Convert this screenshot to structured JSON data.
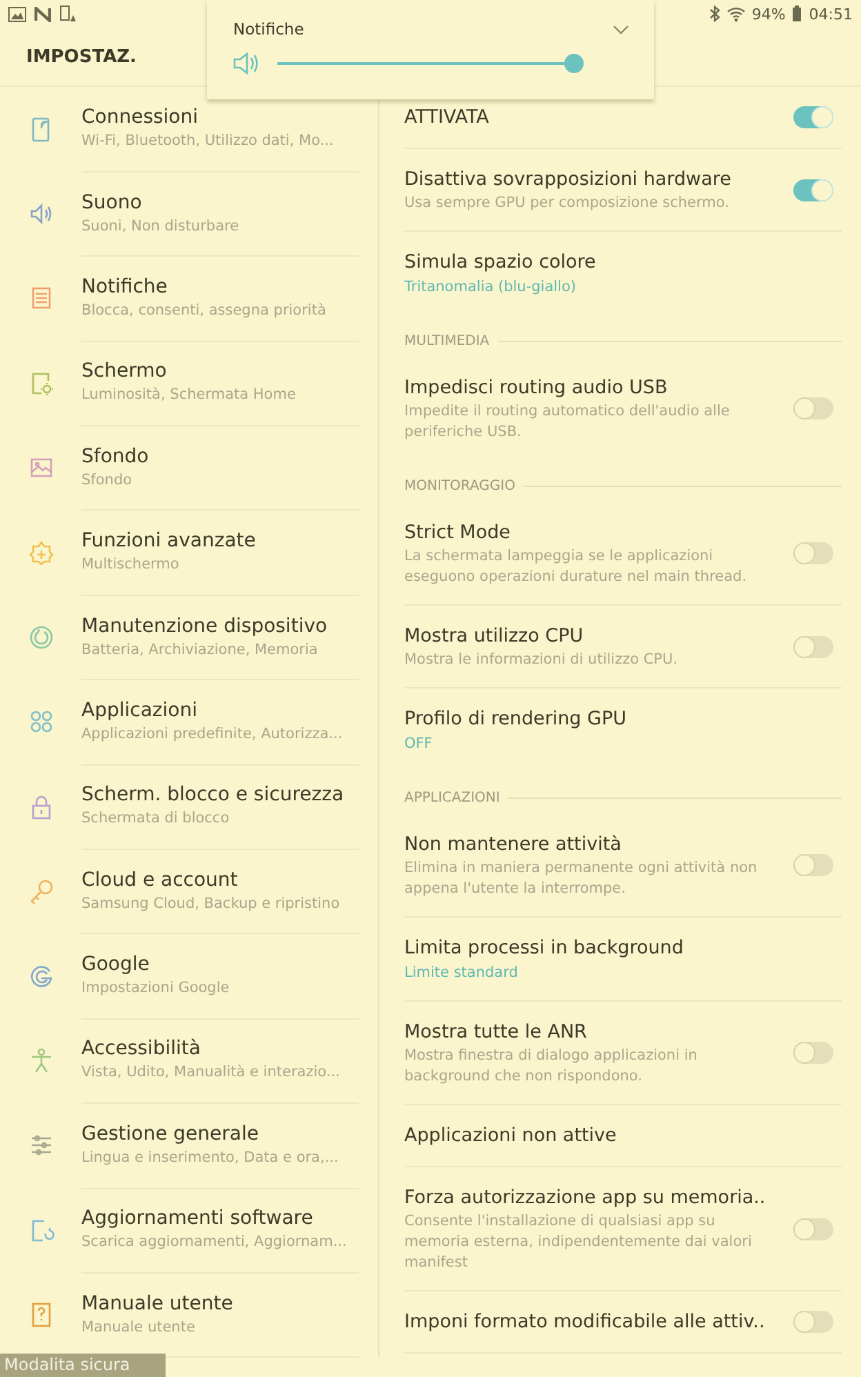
{
  "status_bar": {
    "battery": "94%",
    "time": "04:51"
  },
  "header": {
    "title": "IMPOSTAZ."
  },
  "volume_popup": {
    "title": "Notifiche",
    "level": 1
  },
  "menu": [
    {
      "title": "Connessioni",
      "subtitle": "Wi-Fi, Bluetooth, Utilizzo dati, Mo..."
    },
    {
      "title": "Suono",
      "subtitle": "Suoni, Non disturbare"
    },
    {
      "title": "Notifiche",
      "subtitle": "Blocca, consenti, assegna priorità"
    },
    {
      "title": "Schermo",
      "subtitle": "Luminosità, Schermata Home"
    },
    {
      "title": "Sfondo",
      "subtitle": "Sfondo"
    },
    {
      "title": "Funzioni avanzate",
      "subtitle": "Multischermo"
    },
    {
      "title": "Manutenzione dispositivo",
      "subtitle": "Batteria, Archiviazione, Memoria"
    },
    {
      "title": "Applicazioni",
      "subtitle": "Applicazioni predefinite, Autorizza..."
    },
    {
      "title": "Scherm. blocco e sicurezza",
      "subtitle": "Schermata di blocco"
    },
    {
      "title": "Cloud e account",
      "subtitle": "Samsung Cloud, Backup e ripristino"
    },
    {
      "title": "Google",
      "subtitle": "Impostazioni Google"
    },
    {
      "title": "Accessibilità",
      "subtitle": "Vista, Udito, Manualità e interazio..."
    },
    {
      "title": "Gestione generale",
      "subtitle": "Lingua e inserimento, Data e ora,..."
    },
    {
      "title": "Aggiornamenti software",
      "subtitle": "Scarica aggiornamenti, Aggiornam..."
    },
    {
      "title": "Manuale utente",
      "subtitle": "Manuale utente"
    }
  ],
  "settings": [
    {
      "kind": "toggle",
      "title": "ATTIVATA",
      "on": true
    },
    {
      "kind": "toggle",
      "title": "Disattiva sovrapposizioni hardware",
      "subtitle": "Usa sempre GPU per composizione schermo.",
      "on": true
    },
    {
      "kind": "value",
      "title": "Simula spazio colore",
      "value": "Tritanomalia (blu-giallo)"
    },
    {
      "kind": "header",
      "title": "MULTIMEDIA"
    },
    {
      "kind": "toggle",
      "title": "Impedisci routing audio USB",
      "subtitle": "Impedite il routing automatico dell'audio alle periferiche USB.",
      "on": false
    },
    {
      "kind": "header",
      "title": "MONITORAGGIO"
    },
    {
      "kind": "toggle",
      "title": "Strict Mode",
      "subtitle": "La schermata lampeggia se le applicazioni eseguono operazioni durature nel main thread.",
      "on": false
    },
    {
      "kind": "toggle",
      "title": "Mostra utilizzo CPU",
      "subtitle": "Mostra le informazioni di utilizzo CPU.",
      "on": false
    },
    {
      "kind": "value",
      "title": "Profilo di rendering GPU",
      "value": "OFF"
    },
    {
      "kind": "header",
      "title": "APPLICAZIONI"
    },
    {
      "kind": "toggle",
      "title": "Non mantenere attività",
      "subtitle": "Elimina in maniera permanente ogni attività non appena l'utente la interrompe.",
      "on": false
    },
    {
      "kind": "value",
      "title": "Limita processi in background",
      "value": "Limite standard"
    },
    {
      "kind": "toggle",
      "title": "Mostra tutte le ANR",
      "subtitle": "Mostra finestra di dialogo applicazioni in background che non rispondono.",
      "on": false
    },
    {
      "kind": "plain",
      "title": "Applicazioni non attive"
    },
    {
      "kind": "toggle",
      "title": "Forza autorizzazione app su memoria..",
      "subtitle": "Consente l'installazione di qualsiasi app su memoria esterna, indipendentemente dai valori manifest",
      "on": false
    },
    {
      "kind": "toggle",
      "title": "Imponi formato modificabile alle attiv..",
      "on": false
    }
  ],
  "safe_mode": {
    "label": "Modalita sicura"
  }
}
